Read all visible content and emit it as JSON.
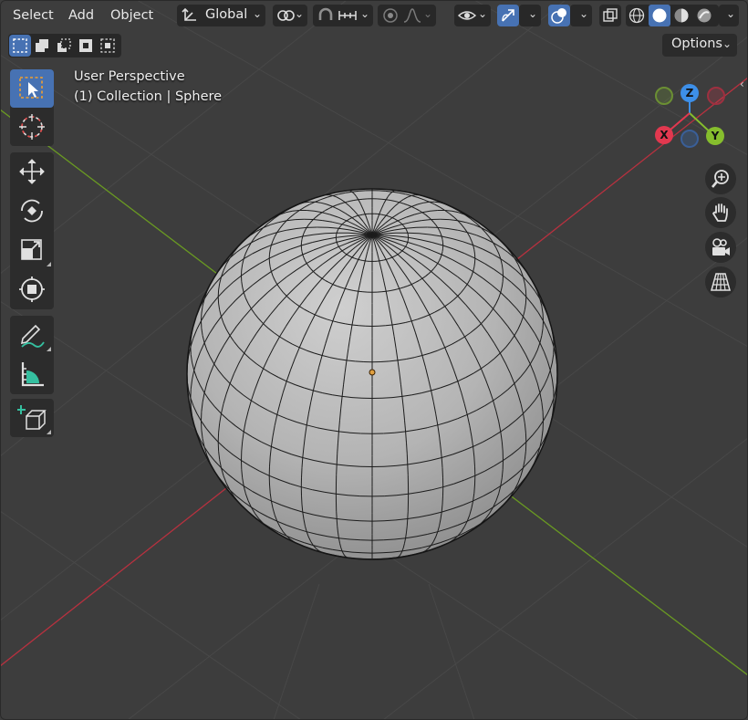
{
  "header": {
    "menu": [
      "Select",
      "Add",
      "Object"
    ],
    "transform_orientation": "Global"
  },
  "toolbar": {
    "tools": [
      {
        "name": "select-box",
        "active": true
      },
      {
        "name": "cursor"
      },
      {
        "name": "move"
      },
      {
        "name": "rotate"
      },
      {
        "name": "scale"
      },
      {
        "name": "transform"
      },
      {
        "name": "annotate"
      },
      {
        "name": "measure"
      },
      {
        "name": "add-cube"
      }
    ]
  },
  "options": {
    "label": "Options"
  },
  "viewport_info": {
    "view_name": "User Perspective",
    "collection_line": "(1) Collection | Sphere"
  },
  "gizmo": {
    "x_label": "X",
    "y_label": "Y",
    "z_label": "Z"
  },
  "colors": {
    "accent": "#4772b3",
    "x_axis": "#e2384f",
    "y_axis": "#86be2d",
    "z_axis": "#3d8fe8",
    "background": "#3d3d3d"
  }
}
